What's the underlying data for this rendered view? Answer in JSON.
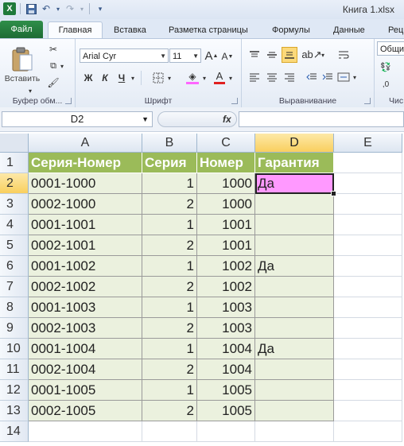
{
  "window": {
    "title": "Книга 1.xlsx"
  },
  "ribbon_tabs": [
    "Файл",
    "Главная",
    "Вставка",
    "Разметка страницы",
    "Формулы",
    "Данные",
    "Рец"
  ],
  "ribbon": {
    "clipboard": {
      "paste_label": "Вставить",
      "group_label": "Буфер обм..."
    },
    "font": {
      "font_name": "Arial Cyr",
      "font_size": "11",
      "bold": "Ж",
      "italic": "К",
      "underline": "Ч",
      "grow": "A",
      "shrink": "A",
      "group_label": "Шрифт"
    },
    "alignment": {
      "group_label": "Выравнивание"
    },
    "number": {
      "format": "Общи",
      "group_label": "Чис"
    }
  },
  "formula_bar": {
    "name_box": "D2",
    "fx_label": "fx",
    "formula": ""
  },
  "grid": {
    "columns": [
      "A",
      "B",
      "C",
      "D",
      "E"
    ],
    "selected_column": "D",
    "selected_row": "2",
    "rows": [
      "1",
      "2",
      "3",
      "4",
      "5",
      "6",
      "7",
      "8",
      "9",
      "10",
      "11",
      "12",
      "13",
      "14"
    ],
    "header": [
      "Серия-Номер",
      "Серия",
      "Номер",
      "Гарантия"
    ],
    "data": [
      [
        "0001-1000",
        "1",
        "1000",
        "Да"
      ],
      [
        "0002-1000",
        "2",
        "1000",
        ""
      ],
      [
        "0001-1001",
        "1",
        "1001",
        ""
      ],
      [
        "0002-1001",
        "2",
        "1001",
        ""
      ],
      [
        "0001-1002",
        "1",
        "1002",
        "Да"
      ],
      [
        "0002-1002",
        "2",
        "1002",
        ""
      ],
      [
        "0001-1003",
        "1",
        "1003",
        ""
      ],
      [
        "0002-1003",
        "2",
        "1003",
        ""
      ],
      [
        "0001-1004",
        "1",
        "1004",
        "Да"
      ],
      [
        "0002-1004",
        "2",
        "1004",
        ""
      ],
      [
        "0001-1005",
        "1",
        "1005",
        ""
      ],
      [
        "0002-1005",
        "2",
        "1005",
        ""
      ]
    ]
  },
  "colors": {
    "header_fill": "#9bbb59",
    "body_fill": "#ebf1de",
    "active_fill": "#ff99ff",
    "file_tab": "#2f8f4a"
  }
}
